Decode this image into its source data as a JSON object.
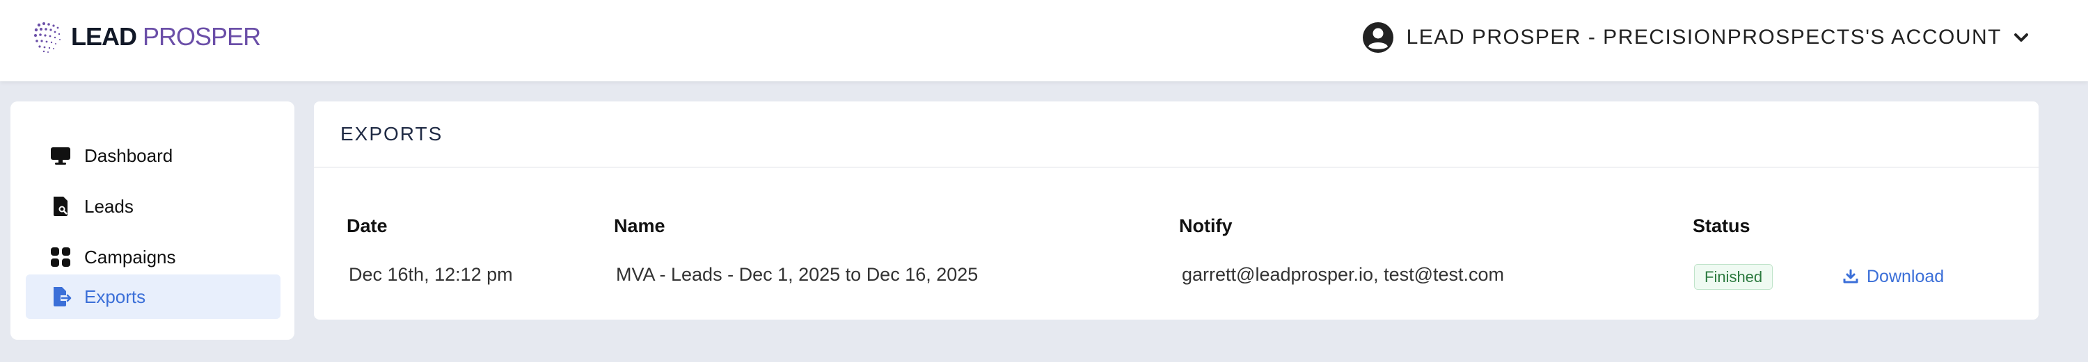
{
  "header": {
    "logo_lead": "LEAD",
    "logo_prosper": "PROSPER",
    "account_name": "LEAD PROSPER - PRECISIONPROSPECTS'S ACCOUNT"
  },
  "sidebar": {
    "items": [
      {
        "label": "Dashboard",
        "icon": "monitor-icon",
        "active": false
      },
      {
        "label": "Leads",
        "icon": "document-search-icon",
        "active": false
      },
      {
        "label": "Campaigns",
        "icon": "grid-icon",
        "active": false
      },
      {
        "label": "Exports",
        "icon": "file-export-icon",
        "active": true
      }
    ]
  },
  "main": {
    "title": "EXPORTS",
    "table": {
      "headers": {
        "date": "Date",
        "name": "Name",
        "notify": "Notify",
        "status": "Status"
      },
      "rows": [
        {
          "date": "Dec 16th, 12:12 pm",
          "name": "MVA - Leads - Dec 1, 2025 to Dec 16, 2025",
          "notify": "garrett@leadprosper.io, test@test.com",
          "status": "Finished",
          "action": "Download"
        }
      ]
    }
  },
  "colors": {
    "accent": "#3b6fd8",
    "brand_purple": "#6b4fa8",
    "status_success": "#2c7a3f",
    "page_bg": "#e6e9f0"
  }
}
